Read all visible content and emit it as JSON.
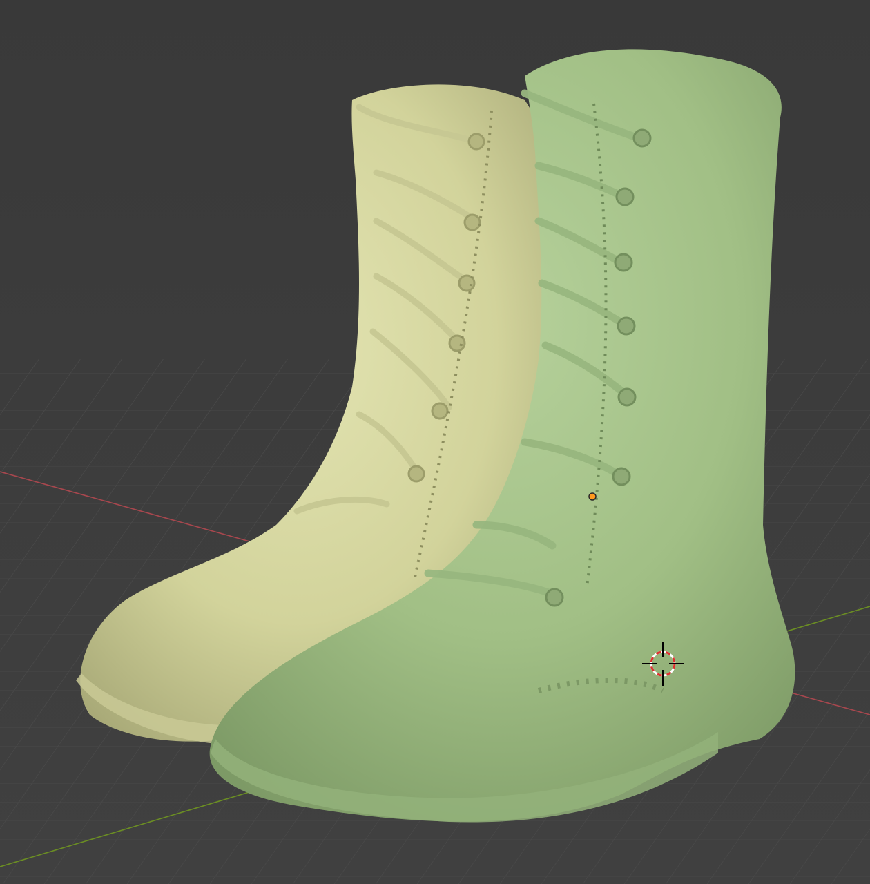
{
  "viewport": {
    "mode": "3d-viewport",
    "background_color": "#3d3d3d",
    "grid_color": "#4a4a4a",
    "x_axis_color": "#a8474e",
    "y_axis_color": "#6b8e23"
  },
  "scene": {
    "objects": [
      {
        "name": "boot-left",
        "color": "#d7d8a2"
      },
      {
        "name": "boot-right",
        "color": "#a6c48a"
      }
    ],
    "cursor_icon": "3d-cursor-icon",
    "origin_icon": "object-origin-icon",
    "origin_color": "#ff9a1f"
  }
}
